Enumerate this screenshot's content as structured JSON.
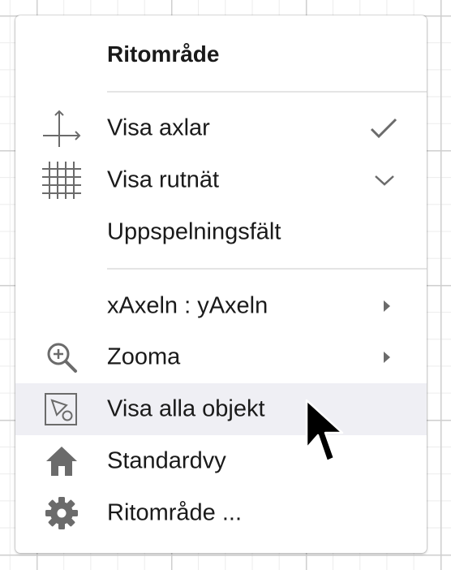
{
  "menu": {
    "title": "Ritområde",
    "items": [
      {
        "label": "Visa axlar",
        "icon": "axes-icon",
        "right": "checkmark-icon",
        "checked": true
      },
      {
        "label": "Visa rutnät",
        "icon": "grid-icon",
        "right": "chevron-down-icon"
      },
      {
        "label": "Uppspelningsfält",
        "icon": null,
        "right": null
      },
      {
        "label": "xAxeln : yAxeln",
        "icon": null,
        "right": "submenu-arrow-icon"
      },
      {
        "label": "Zooma",
        "icon": "zoom-in-icon",
        "right": "submenu-arrow-icon"
      },
      {
        "label": "Visa alla objekt",
        "icon": "show-all-objects-icon",
        "right": null,
        "highlighted": true
      },
      {
        "label": "Standardvy",
        "icon": "home-icon",
        "right": null
      },
      {
        "label": "Ritområde ...",
        "icon": "gear-icon",
        "right": null
      }
    ]
  },
  "colors": {
    "highlight": "#efeff4",
    "icon": "#6b6b6b",
    "separator": "#e4e4e4",
    "text": "#1a1a1a"
  }
}
